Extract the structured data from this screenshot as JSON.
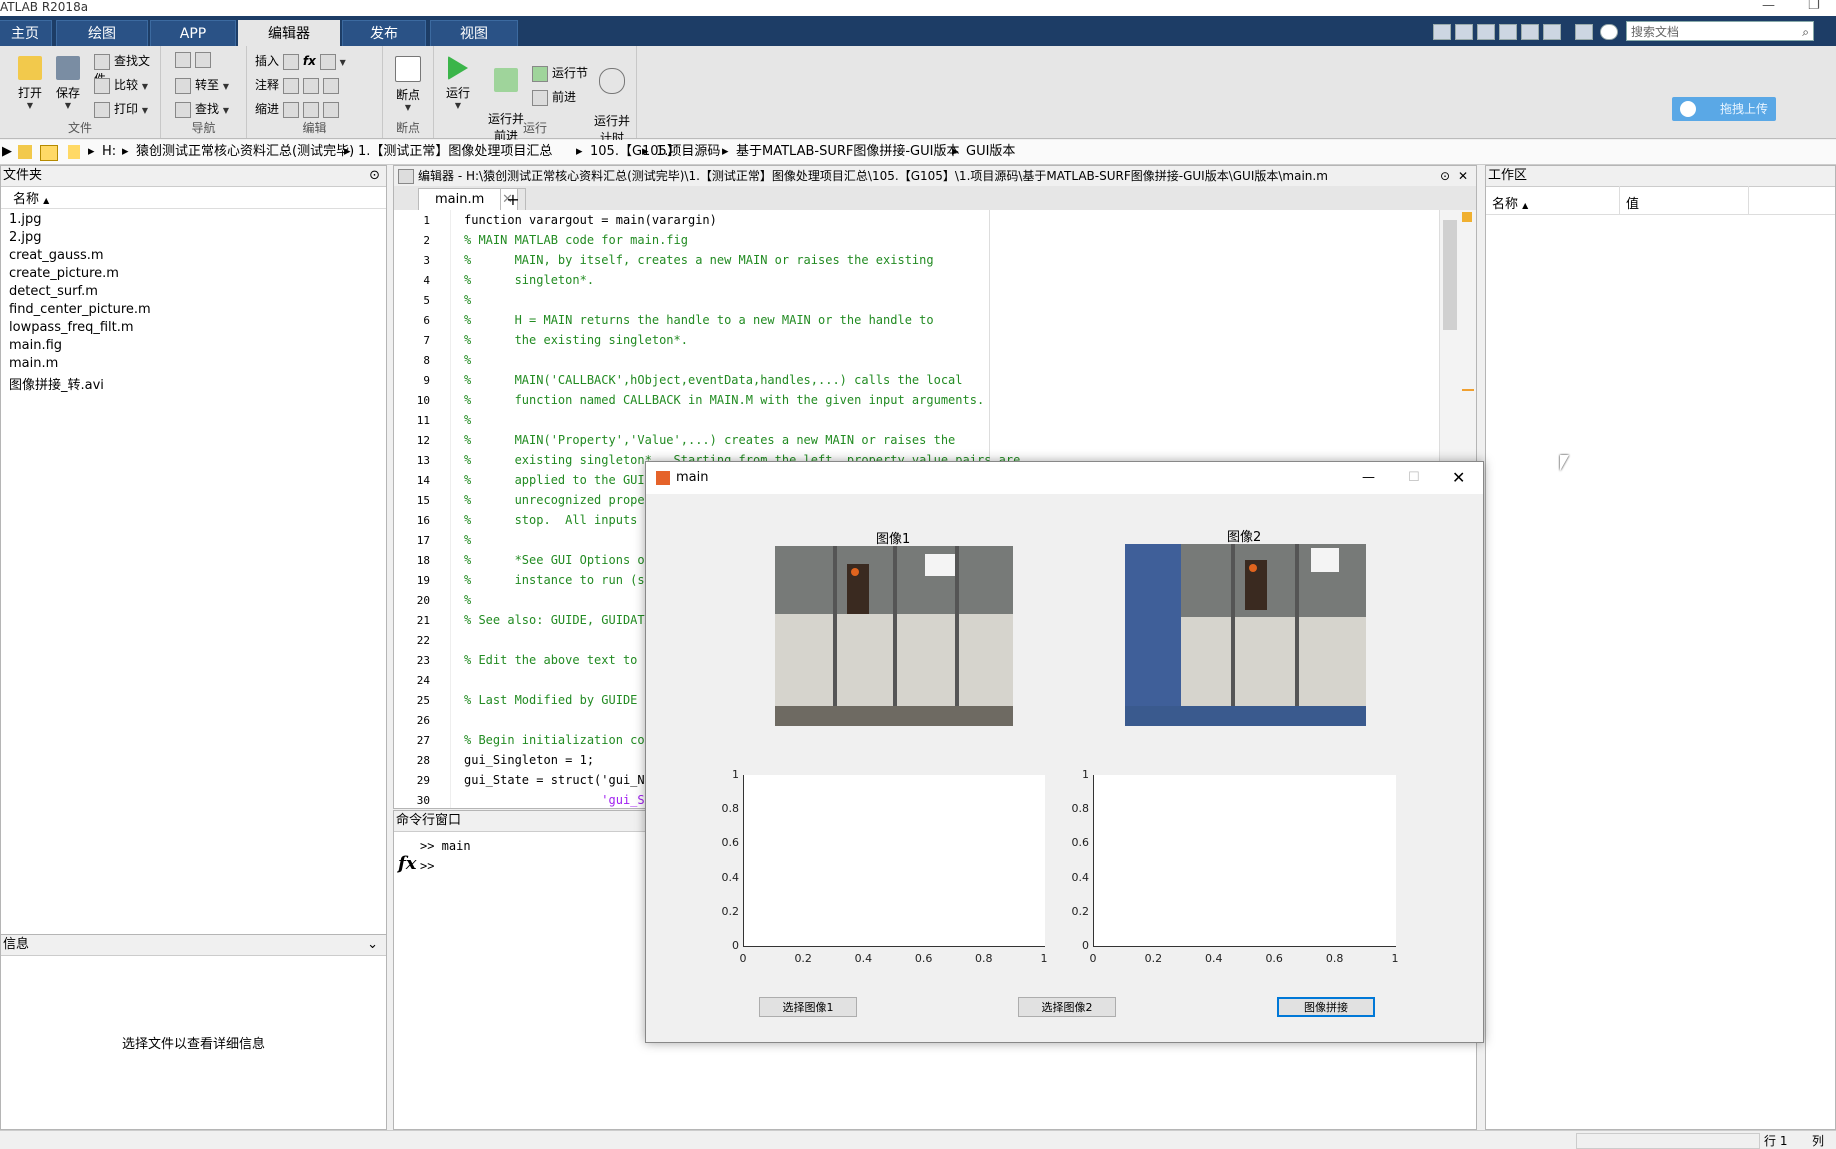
{
  "window_title": "ATLAB R2018a",
  "tabs": [
    "主页",
    "绘图",
    "APP",
    "编辑器",
    "发布",
    "视图"
  ],
  "active_tab": "编辑器",
  "search_placeholder": "搜索文档",
  "ribbon": {
    "file": {
      "label": "文件",
      "open": "打开",
      "save": "保存",
      "find_files": "查找文件",
      "compare": "比较",
      "print": "打印"
    },
    "navigate": {
      "label": "导航",
      "goto": "转至",
      "find": "查找"
    },
    "edit": {
      "label": "编辑",
      "insert": "插入",
      "comment": "注释",
      "indent": "缩进",
      "fx": "fx"
    },
    "breakpoints": {
      "label": "断点",
      "breakpoints": "断点"
    },
    "run": {
      "label": "运行",
      "run": "运行",
      "run_advance": "运行并\n前进",
      "run_section": "运行节",
      "advance": "前进",
      "run_time": "运行并\n计时"
    }
  },
  "baidu_button": "拖拽上传",
  "address": [
    "H:",
    "猿创测试正常核心资料汇总(测试完毕)",
    "1.【测试正常】图像处理项目汇总",
    "105.【G105】",
    "1.项目源码",
    "基于MATLAB-SURF图像拼接-GUI版本",
    "GUI版本"
  ],
  "current_folder": {
    "title": "文件夹",
    "col_name": "名称",
    "files": [
      "1.jpg",
      "2.jpg",
      "creat_gauss.m",
      "create_picture.m",
      "detect_surf.m",
      "find_center_picture.m",
      "lowpass_freq_filt.m",
      "main.fig",
      "main.m",
      "图像拼接_转.avi"
    ]
  },
  "details": {
    "title": "信息",
    "message": "选择文件以查看详细信息"
  },
  "editor": {
    "title": "编辑器 - H:\\猿创测试正常核心资料汇总(测试完毕)\\1.【测试正常】图像处理项目汇总\\105.【G105】\\1.项目源码\\基于MATLAB-SURF图像拼接-GUI版本\\GUI版本\\main.m",
    "tab": "main.m",
    "lines": [
      {
        "n": "1",
        "t": "function varargout = main(varargin)"
      },
      {
        "n": "2",
        "t": "% MAIN MATLAB code for main.fig"
      },
      {
        "n": "3",
        "t": "%      MAIN, by itself, creates a new MAIN or raises the existing"
      },
      {
        "n": "4",
        "t": "%      singleton*."
      },
      {
        "n": "5",
        "t": "%"
      },
      {
        "n": "6",
        "t": "%      H = MAIN returns the handle to a new MAIN or the handle to"
      },
      {
        "n": "7",
        "t": "%      the existing singleton*."
      },
      {
        "n": "8",
        "t": "%"
      },
      {
        "n": "9",
        "t": "%      MAIN('CALLBACK',hObject,eventData,handles,...) calls the local"
      },
      {
        "n": "10",
        "t": "%      function named CALLBACK in MAIN.M with the given input arguments."
      },
      {
        "n": "11",
        "t": "%"
      },
      {
        "n": "12",
        "t": "%      MAIN('Property','Value',...) creates a new MAIN or raises the"
      },
      {
        "n": "13",
        "t": "%      existing singleton*.  Starting from the left, property value pairs are"
      },
      {
        "n": "14",
        "t": "%      applied to the GUI"
      },
      {
        "n": "15",
        "t": "%      unrecognized proper"
      },
      {
        "n": "16",
        "t": "%      stop.  All inputs a"
      },
      {
        "n": "17",
        "t": "%"
      },
      {
        "n": "18",
        "t": "%      *See GUI Options on"
      },
      {
        "n": "19",
        "t": "%      instance to run (si"
      },
      {
        "n": "20",
        "t": "%"
      },
      {
        "n": "21",
        "t": "% See also: GUIDE, GUIDATA"
      },
      {
        "n": "22",
        "t": ""
      },
      {
        "n": "23",
        "t": "% Edit the above text to m"
      },
      {
        "n": "24",
        "t": ""
      },
      {
        "n": "25",
        "t": "% Last Modified by GUIDE v"
      },
      {
        "n": "26",
        "t": ""
      },
      {
        "n": "27",
        "t": "% Begin initialization cod"
      },
      {
        "n": "28",
        "t": "gui_Singleton = 1;"
      },
      {
        "n": "29",
        "t": "gui_State = struct('gui_Na"
      },
      {
        "n": "30",
        "t": "                   'gui_Si"
      }
    ]
  },
  "command_window": {
    "title": "命令行窗口",
    "line1": ">> main",
    "prompt": ">>",
    "fx": "fx"
  },
  "workspace": {
    "title": "工作区",
    "col_name": "名称",
    "col_value": "值"
  },
  "status": {
    "row": "行  1",
    "col": "列"
  },
  "figure": {
    "title": "main",
    "image1_title": "图像1",
    "image2_title": "图像2",
    "yticks": [
      "1",
      "0.8",
      "0.6",
      "0.4",
      "0.2",
      "0"
    ],
    "xticks": [
      "0",
      "0.2",
      "0.4",
      "0.6",
      "0.8",
      "1"
    ],
    "btn_select1": "选择图像1",
    "btn_select2": "选择图像2",
    "btn_stitch": "图像拼接"
  }
}
